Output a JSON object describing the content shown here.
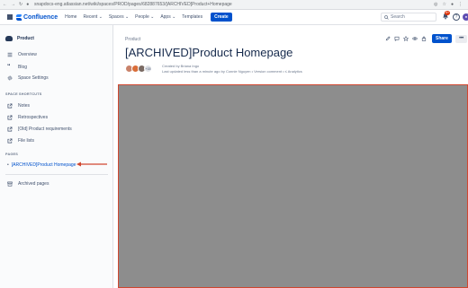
{
  "browser": {
    "url": "snapdocs-eng.atlassian.net/wiki/spaces/PROD/pages/682887653/[ARCHIVED]Product+Homepage"
  },
  "topnav": {
    "product": "Confluence",
    "items": [
      "Home",
      "Recent ⌄",
      "Spaces ⌄",
      "People ⌄",
      "Apps ⌄",
      "Templates"
    ],
    "create_label": "Create",
    "search_placeholder": "Search",
    "notification_count": "9+"
  },
  "sidebar": {
    "space_name": "Product",
    "nav_items": [
      "Overview",
      "Blog",
      "Space Settings"
    ],
    "shortcuts_heading": "SPACE SHORTCUTS",
    "shortcuts": [
      "Notes",
      "Retrospectives",
      "[Old] Product requirements",
      "File lists"
    ],
    "pages_heading": "PAGES",
    "current_page": "[ARCHIVED]Product Homepage",
    "archived_label": "Archived pages"
  },
  "page": {
    "breadcrumb": "Product",
    "title": "[ARCHIVED]Product Homepage",
    "created_by": "Created by Briana Ingo",
    "last_updated": "Last updated less than a minute ago by Connie Nguyen  •  Version comment  •  ≤ Analytics",
    "avatar_overflow": "+15",
    "share_label": "Share",
    "more_label": "•••"
  },
  "colors": {
    "brand_blue": "#0052cc",
    "content_placeholder": "#8d8d8d",
    "annotation_red": "#d0472f"
  }
}
